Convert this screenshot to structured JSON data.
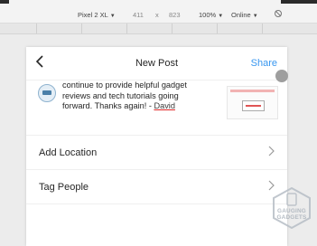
{
  "devtools": {
    "device": "Pixel 2 XL",
    "width": "411",
    "times": "x",
    "height": "823",
    "zoom": "100%",
    "network": "Online",
    "caret": "▼",
    "rotate_icon": "rotate-icon"
  },
  "header": {
    "back_icon": "chevron-left-icon",
    "title": "New Post",
    "share_label": "Share"
  },
  "caption": {
    "lines": [
      "continue to provide helpful gadget",
      "reviews and tech tutorials going"
    ],
    "last_line_prefix": "forward. Thanks again! - ",
    "signature": "David"
  },
  "rows": [
    {
      "label": "Add Location",
      "icon": "chevron-right-icon"
    },
    {
      "label": "Tag People",
      "icon": "chevron-right-icon"
    }
  ],
  "watermark": {
    "line1": "GAUGING",
    "line2": "GADGETS"
  },
  "colors": {
    "accent": "#3897f0",
    "signature_underline": "#e02828"
  }
}
